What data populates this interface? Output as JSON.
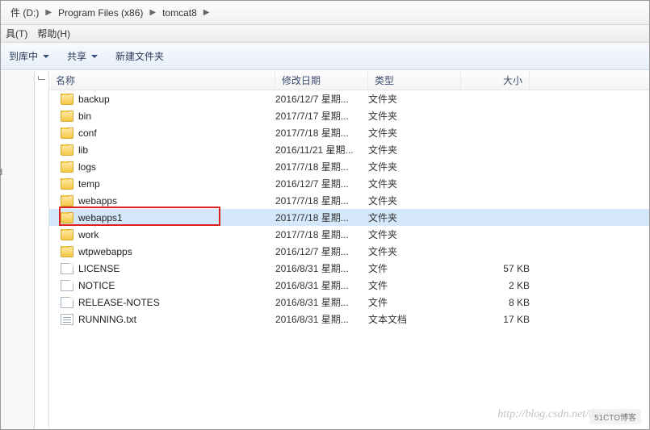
{
  "breadcrumb": {
    "seg0": "件 (D:)",
    "seg1": "Program Files (x86)",
    "seg2": "tomcat8"
  },
  "menubar": {
    "tools": "具(T)",
    "help": "帮助(H)"
  },
  "toolbar": {
    "include": "到库中",
    "share": "共享",
    "newfolder": "新建文件夹"
  },
  "leftpane": {
    "text": "d"
  },
  "columns": {
    "name": "名称",
    "date": "修改日期",
    "type": "类型",
    "size": "大小"
  },
  "rows": [
    {
      "icon": "folder",
      "name": "backup",
      "date": "2016/12/7 星期...",
      "type": "文件夹",
      "size": ""
    },
    {
      "icon": "folder",
      "name": "bin",
      "date": "2017/7/17 星期...",
      "type": "文件夹",
      "size": ""
    },
    {
      "icon": "folder",
      "name": "conf",
      "date": "2017/7/18 星期...",
      "type": "文件夹",
      "size": ""
    },
    {
      "icon": "folder",
      "name": "lib",
      "date": "2016/11/21 星期...",
      "type": "文件夹",
      "size": ""
    },
    {
      "icon": "folder",
      "name": "logs",
      "date": "2017/7/18 星期...",
      "type": "文件夹",
      "size": ""
    },
    {
      "icon": "folder",
      "name": "temp",
      "date": "2016/12/7 星期...",
      "type": "文件夹",
      "size": ""
    },
    {
      "icon": "folder",
      "name": "webapps",
      "date": "2017/7/18 星期...",
      "type": "文件夹",
      "size": ""
    },
    {
      "icon": "folder",
      "name": "webapps1",
      "date": "2017/7/18 星期...",
      "type": "文件夹",
      "size": "",
      "selected": true,
      "highlighted": true
    },
    {
      "icon": "folder",
      "name": "work",
      "date": "2017/7/18 星期...",
      "type": "文件夹",
      "size": ""
    },
    {
      "icon": "folder",
      "name": "wtpwebapps",
      "date": "2016/12/7 星期...",
      "type": "文件夹",
      "size": ""
    },
    {
      "icon": "file",
      "name": "LICENSE",
      "date": "2016/8/31 星期...",
      "type": "文件",
      "size": "57 KB"
    },
    {
      "icon": "file",
      "name": "NOTICE",
      "date": "2016/8/31 星期...",
      "type": "文件",
      "size": "2 KB"
    },
    {
      "icon": "file",
      "name": "RELEASE-NOTES",
      "date": "2016/8/31 星期...",
      "type": "文件",
      "size": "8 KB"
    },
    {
      "icon": "txt",
      "name": "RUNNING.txt",
      "date": "2016/8/31 星期...",
      "type": "文本文档",
      "size": "17 KB"
    }
  ],
  "watermark": {
    "text": "http://blog.csdn.net/dreamstar",
    "badge": "51CTO博客"
  }
}
